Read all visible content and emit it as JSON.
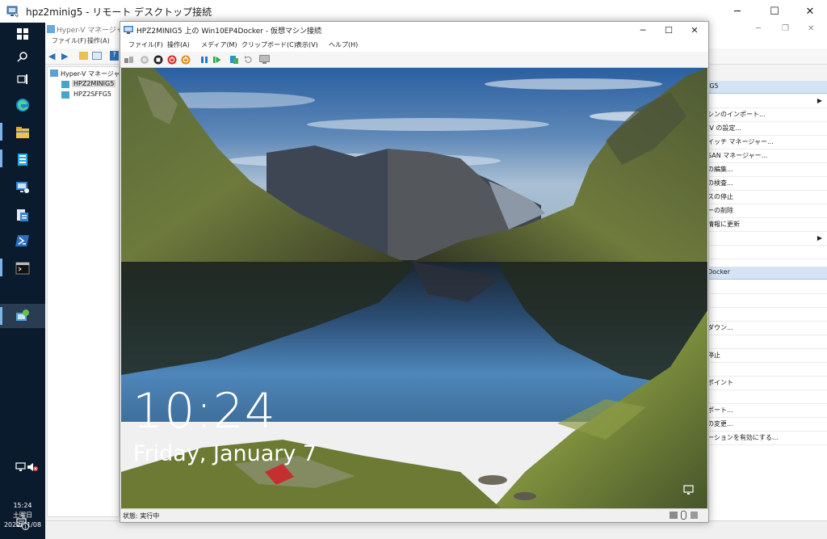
{
  "rdp": {
    "title": "hpz2minig5 - リモート デスクトップ接続",
    "minimize": "─",
    "maximize": "☐",
    "close": "✕"
  },
  "taskbar": {
    "icons": [
      "windows-start-icon",
      "search-icon",
      "task-view-icon",
      "edge-icon",
      "file-explorer-icon",
      "server-manager-icon",
      "remote-desktop-icon",
      "admin-tools-icon",
      "powershell-icon",
      "command-prompt-icon",
      "hyper-v-manager-icon"
    ],
    "clock": {
      "time": "15:24",
      "weekday": "土曜日",
      "date": "2022/01/08"
    },
    "notification_count": "1"
  },
  "hyperv_manager": {
    "title": "Hyper-V マネージャー",
    "menu": [
      "ファイル(F)",
      "操作(A)"
    ],
    "tree": {
      "root": "Hyper-V マネージャー",
      "servers": [
        "HPZ2MINIG5",
        "HPZ2SFFG5"
      ]
    },
    "actions": {
      "server_header": "IG5",
      "server_items": [
        "",
        "シンのインポート...",
        "-V の設定...",
        "イッチ マネージャー...",
        "SAN マネージャー...",
        "の編集...",
        "の検査...",
        "スの停止",
        "ーの削除",
        "情報に更新",
        "",
        ""
      ],
      "vm_header": "Docker",
      "vm_items": [
        "",
        "",
        "",
        "ダウン...",
        "",
        "停止",
        "",
        "ポイント",
        "",
        "ポート...",
        "の変更...",
        "ーションを有効にする..."
      ]
    }
  },
  "vm_connection": {
    "title": "HPZ2MINIG5 上の Win10EP4Docker - 仮想マシン接続",
    "menu": [
      "ファイル(F)",
      "操作(A)",
      "メディア(M)",
      "クリップボード(C)",
      "表示(V)",
      "ヘルプ(H)"
    ],
    "toolbar": [
      "ctrl-alt-del-icon",
      "start-icon",
      "turn-off-icon",
      "shut-down-icon",
      "save-icon",
      "pause-icon",
      "resume-icon",
      "checkpoint-icon",
      "revert-icon",
      "enhanced-session-icon"
    ],
    "lock_screen": {
      "time": "10:24",
      "date": "Friday, January 7"
    },
    "status": "状態: 実行中"
  }
}
